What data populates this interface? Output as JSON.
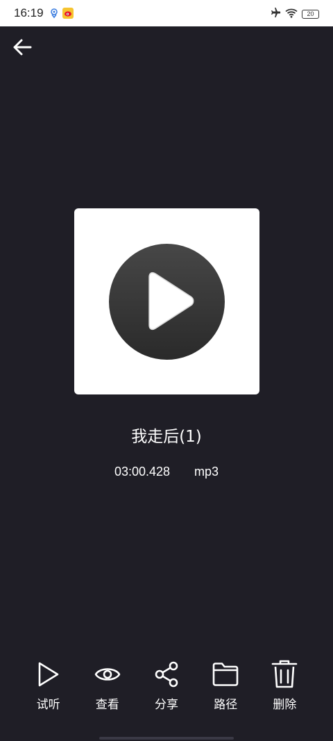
{
  "status_bar": {
    "time": "16:19",
    "battery": "20",
    "icons": [
      "app-notification-icon",
      "weibo-icon",
      "airplane-mode-icon",
      "wifi-icon",
      "battery-icon"
    ]
  },
  "header": {
    "back_icon": "arrow-left-icon"
  },
  "player": {
    "cover_icon": "play-disc-icon",
    "title": "我走后(1)",
    "duration": "03:00.428",
    "format": "mp3"
  },
  "toolbar": {
    "items": [
      {
        "label": "试听",
        "icon": "play-icon"
      },
      {
        "label": "查看",
        "icon": "eye-icon"
      },
      {
        "label": "分享",
        "icon": "share-icon"
      },
      {
        "label": "路径",
        "icon": "folder-icon"
      },
      {
        "label": "删除",
        "icon": "trash-icon"
      }
    ]
  },
  "colors": {
    "background": "#1f1e26",
    "status_bar": "#ffffff",
    "card": "#ffffff",
    "disc": "#3a3a3a",
    "text": "#ffffff"
  }
}
